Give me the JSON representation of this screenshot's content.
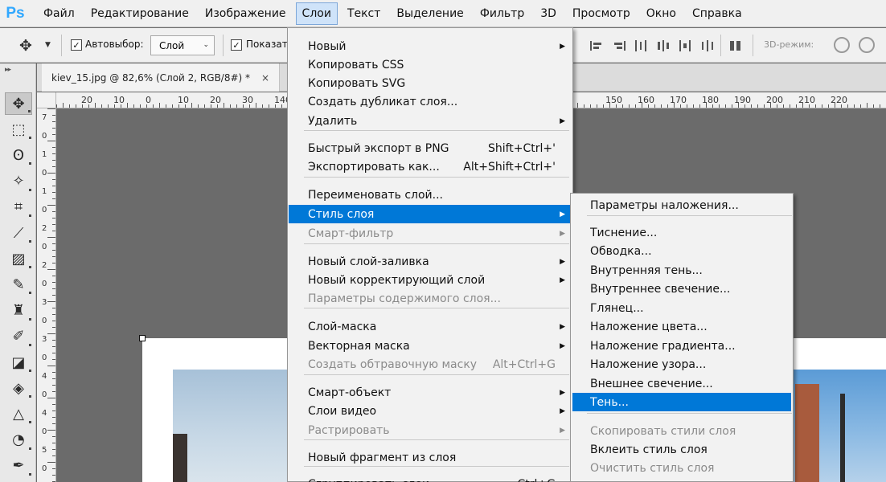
{
  "app": {
    "logo": "Ps",
    "menubar": [
      "Файл",
      "Редактирование",
      "Изображение",
      "Слои",
      "Текст",
      "Выделение",
      "Фильтр",
      "3D",
      "Просмотр",
      "Окно",
      "Справка"
    ],
    "active_menu_index": 3
  },
  "options": {
    "autoselect_label": "Автовыбор:",
    "autoselect_checked": true,
    "target_select_value": "Слой",
    "show_label": "Показать",
    "show_checked": true,
    "threed_label": "3D-режим:"
  },
  "document": {
    "tab_title": "kiev_15.jpg @ 82,6% (Слой 2, RGB/8#) *",
    "close_glyph": "×"
  },
  "ruler": {
    "h_labels": [
      "20",
      "10",
      "0",
      "10",
      "20",
      "30",
      "140",
      "150",
      "160",
      "170",
      "180",
      "190",
      "200",
      "210",
      "220"
    ],
    "v_labels": [
      "7",
      "0",
      "1",
      "0",
      "1",
      "0",
      "2",
      "0",
      "2",
      "0",
      "3",
      "0",
      "3",
      "0",
      "4",
      "0",
      "4",
      "0",
      "5",
      "0"
    ]
  },
  "layer_menu": {
    "items": [
      {
        "label": "Новый",
        "shortcut": "",
        "submenu": true,
        "disabled": false
      },
      {
        "label": "Копировать CSS",
        "shortcut": "",
        "submenu": false,
        "disabled": false
      },
      {
        "label": "Копировать SVG",
        "shortcut": "",
        "submenu": false,
        "disabled": false
      },
      {
        "label": "Создать дубликат слоя...",
        "shortcut": "",
        "submenu": false,
        "disabled": false
      },
      {
        "label": "Удалить",
        "shortcut": "",
        "submenu": true,
        "disabled": false
      },
      {
        "label": "Быстрый экспорт в PNG",
        "shortcut": "Shift+Ctrl+'",
        "submenu": false,
        "disabled": false
      },
      {
        "label": "Экспортировать как...",
        "shortcut": "Alt+Shift+Ctrl+'",
        "submenu": false,
        "disabled": false
      },
      {
        "label": "Переименовать слой...",
        "shortcut": "",
        "submenu": false,
        "disabled": false
      },
      {
        "label": "Стиль слоя",
        "shortcut": "",
        "submenu": true,
        "disabled": false,
        "highlighted": true
      },
      {
        "label": "Смарт-фильтр",
        "shortcut": "",
        "submenu": true,
        "disabled": true
      },
      {
        "label": "Новый слой-заливка",
        "shortcut": "",
        "submenu": true,
        "disabled": false
      },
      {
        "label": "Новый корректирующий слой",
        "shortcut": "",
        "submenu": true,
        "disabled": false
      },
      {
        "label": "Параметры содержимого слоя...",
        "shortcut": "",
        "submenu": false,
        "disabled": true
      },
      {
        "label": "Слой-маска",
        "shortcut": "",
        "submenu": true,
        "disabled": false
      },
      {
        "label": "Векторная маска",
        "shortcut": "",
        "submenu": true,
        "disabled": false
      },
      {
        "label": "Создать обтравочную маску",
        "shortcut": "Alt+Ctrl+G",
        "submenu": false,
        "disabled": true
      },
      {
        "label": "Смарт-объект",
        "shortcut": "",
        "submenu": true,
        "disabled": false
      },
      {
        "label": "Слои видео",
        "shortcut": "",
        "submenu": true,
        "disabled": false
      },
      {
        "label": "Растрировать",
        "shortcut": "",
        "submenu": true,
        "disabled": true
      },
      {
        "label": "Новый фрагмент из слоя",
        "shortcut": "",
        "submenu": false,
        "disabled": false
      },
      {
        "label": "Сгруппировать слои",
        "shortcut": "Ctrl+G",
        "submenu": false,
        "disabled": false
      }
    ]
  },
  "layer_style_submenu": {
    "items": [
      {
        "label": "Параметры наложения...",
        "disabled": false
      },
      {
        "label": "Тиснение...",
        "disabled": false
      },
      {
        "label": "Обводка...",
        "disabled": false
      },
      {
        "label": "Внутренняя тень...",
        "disabled": false
      },
      {
        "label": "Внутреннее свечение...",
        "disabled": false
      },
      {
        "label": "Глянец...",
        "disabled": false
      },
      {
        "label": "Наложение цвета...",
        "disabled": false
      },
      {
        "label": "Наложение градиента...",
        "disabled": false
      },
      {
        "label": "Наложение узора...",
        "disabled": false
      },
      {
        "label": "Внешнее свечение...",
        "disabled": false
      },
      {
        "label": "Тень...",
        "disabled": false,
        "highlighted": true
      },
      {
        "label": "Скопировать стили слоя",
        "disabled": true
      },
      {
        "label": "Вклеить стиль слоя",
        "disabled": false
      },
      {
        "label": "Очистить стиль слоя",
        "disabled": true
      }
    ]
  },
  "tools": [
    "move-tool-icon",
    "marquee-tool-icon",
    "lasso-tool-icon",
    "magic-wand-tool-icon",
    "crop-tool-icon",
    "eyedropper-tool-icon",
    "healing-brush-tool-icon",
    "brush-tool-icon",
    "clone-stamp-tool-icon",
    "history-brush-tool-icon",
    "eraser-tool-icon",
    "paint-bucket-tool-icon",
    "sharpen-tool-icon",
    "dodge-tool-icon",
    "pen-tool-icon"
  ],
  "colors": {
    "ps_blue": "#31a8ff",
    "highlight": "#0078d7",
    "canvas_bg": "#6b6b6b"
  }
}
